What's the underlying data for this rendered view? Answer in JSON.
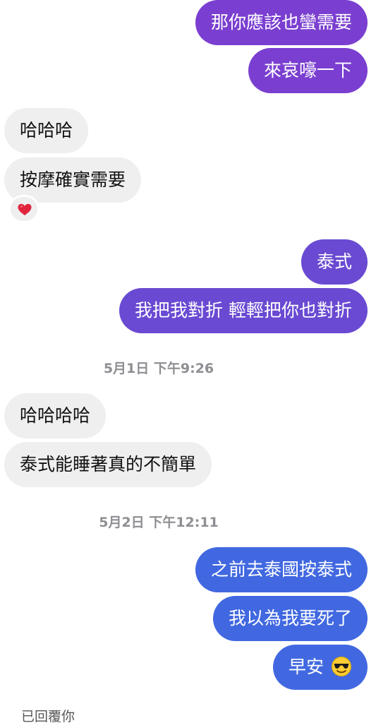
{
  "messages": {
    "m1": "那你應該也蠻需要",
    "m2": "來哀嚎一下",
    "m3": "哈哈哈",
    "m4": "按摩確實需要",
    "m5": "泰式",
    "m6": "我把我對折 輕輕把你也對折",
    "m7": "哈哈哈哈",
    "m8": "泰式能睡著真的不簡單",
    "m9": "之前去泰國按泰式",
    "m10": "我以為我要死了",
    "m11": "早安"
  },
  "timestamps": {
    "t1": "5月1日 下午9:26",
    "t2": "5月2日 下午12:11"
  },
  "reaction": {
    "icon": "red-heart-icon",
    "color": "#e0243c"
  },
  "emoji": {
    "icon": "sunglasses-face-icon"
  },
  "status": {
    "seen_label": "已回覆你"
  },
  "colors": {
    "outgoing_purple": "#7a3fd0",
    "outgoing_violet": "#6a4ad2",
    "outgoing_blue": "#4168e0",
    "incoming_gray": "#efeff0"
  }
}
